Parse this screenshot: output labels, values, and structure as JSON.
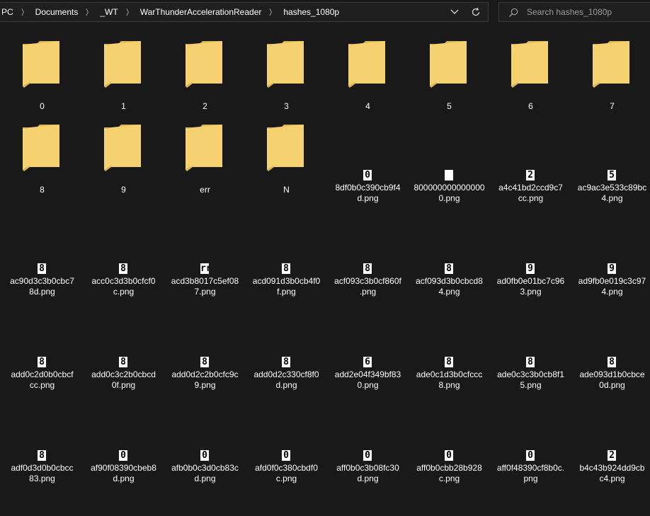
{
  "address": {
    "crumbs": [
      "PC",
      "Documents",
      "_WT",
      "WarThunderAccelerationReader",
      "hashes_1080p"
    ],
    "separator": "〉"
  },
  "search": {
    "placeholder": "Search hashes_1080p"
  },
  "folders": [
    {
      "name": "0"
    },
    {
      "name": "1"
    },
    {
      "name": "2"
    },
    {
      "name": "3"
    },
    {
      "name": "4"
    },
    {
      "name": "5"
    },
    {
      "name": "6"
    },
    {
      "name": "7"
    },
    {
      "name": "8"
    },
    {
      "name": "9"
    },
    {
      "name": "err"
    },
    {
      "name": "N"
    }
  ],
  "files": [
    {
      "line1": "8df0b0c390cb9f4",
      "line2": "d.png",
      "glyph": "0"
    },
    {
      "line1": "800000000000000",
      "line2": "0.png",
      "glyph": ""
    },
    {
      "line1": "a4c41bd2ccd9c7",
      "line2": "cc.png",
      "glyph": "2"
    },
    {
      "line1": "ac9ac3e533c89bc",
      "line2": "4.png",
      "glyph": "5"
    },
    {
      "line1": "ac90d3c3b0cbc7",
      "line2": "8d.png",
      "glyph": "8"
    },
    {
      "line1": "acc0c3d3b0cfcf0",
      "line2": "c.png",
      "glyph": "8"
    },
    {
      "line1": "acd3b8017c5ef08",
      "line2": "7.png",
      "glyph": "rr"
    },
    {
      "line1": "acd091d3b0cb4f0",
      "line2": "f.png",
      "glyph": "8"
    },
    {
      "line1": "acf093c3b0cf860f",
      "line2": ".png",
      "glyph": "8"
    },
    {
      "line1": "acf093d3b0cbcd8",
      "line2": "4.png",
      "glyph": "8"
    },
    {
      "line1": "ad0fb0e01bc7c96",
      "line2": "3.png",
      "glyph": "9"
    },
    {
      "line1": "ad9fb0e019c3c97",
      "line2": "4.png",
      "glyph": "9"
    },
    {
      "line1": "add0c2d0b0cbcf",
      "line2": "cc.png",
      "glyph": "8"
    },
    {
      "line1": "add0c3c2b0cbcd",
      "line2": "0f.png",
      "glyph": "8"
    },
    {
      "line1": "add0d2c2b0cfc9c",
      "line2": "9.png",
      "glyph": "8"
    },
    {
      "line1": "add0d2c330cf8f0",
      "line2": "d.png",
      "glyph": "8"
    },
    {
      "line1": "add2e04f349bf83",
      "line2": "0.png",
      "glyph": "6"
    },
    {
      "line1": "ade0c1d3b0cfccc",
      "line2": "8.png",
      "glyph": "8"
    },
    {
      "line1": "ade0c3c3b0cb8f1",
      "line2": "5.png",
      "glyph": "8"
    },
    {
      "line1": "ade093d1b0cbce",
      "line2": "0d.png",
      "glyph": "8"
    },
    {
      "line1": "adf0d3d0b0cbcc",
      "line2": "83.png",
      "glyph": "8"
    },
    {
      "line1": "af90f08390cbeb8",
      "line2": "d.png",
      "glyph": "0"
    },
    {
      "line1": "afb0b0c3d0cb83c",
      "line2": "d.png",
      "glyph": "0"
    },
    {
      "line1": "afd0f0c380cbdf0",
      "line2": "c.png",
      "glyph": "0"
    },
    {
      "line1": "aff0b0c3b08fc30",
      "line2": "d.png",
      "glyph": "0"
    },
    {
      "line1": "aff0b0cbb28b928",
      "line2": "c.png",
      "glyph": "0"
    },
    {
      "line1": "aff0f48390cf8b0c.",
      "line2": "png",
      "glyph": "0"
    },
    {
      "line1": "b4c43b924dd9cb",
      "line2": "c4.png",
      "glyph": "2"
    }
  ],
  "colors": {
    "background": "#191919",
    "folder": "#f6d170",
    "folder_dark": "#e2b553",
    "text": "#ffffff"
  }
}
